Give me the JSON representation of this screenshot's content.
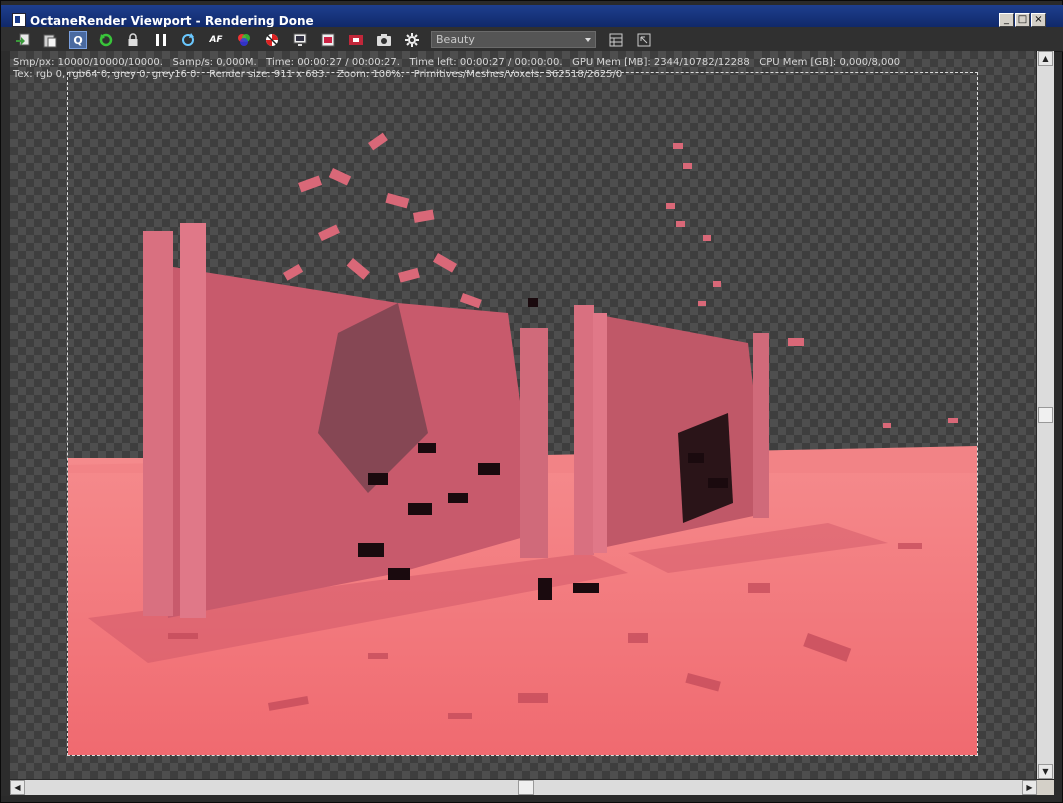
{
  "window": {
    "title": "OctaneRender Viewport - Rendering Done",
    "controls": {
      "minimize": "_",
      "maximize": "□",
      "close": "×"
    }
  },
  "toolbar": {
    "buttons": [
      {
        "name": "send-scene-icon"
      },
      {
        "name": "clipboard-icon"
      },
      {
        "name": "q-region-icon",
        "label": "Q"
      },
      {
        "name": "restart-icon"
      },
      {
        "name": "lock-icon"
      },
      {
        "name": "pause-icon"
      },
      {
        "name": "refresh-icon"
      },
      {
        "name": "af-focus-icon",
        "label": "AF"
      },
      {
        "name": "color-picker-icon"
      },
      {
        "name": "material-picker-icon"
      },
      {
        "name": "display-icon"
      },
      {
        "name": "film-icon"
      },
      {
        "name": "render-region-icon"
      },
      {
        "name": "camera-icon"
      },
      {
        "name": "settings-gear-icon"
      }
    ],
    "pass_select": "Beauty",
    "right_buttons": [
      {
        "name": "layout-icon"
      },
      {
        "name": "fit-view-icon"
      }
    ]
  },
  "status": {
    "line1": "Smp/px: 10000/10000/10000.   Samp/s: 0,000M.   Time: 00:00:27 / 00:00:27.   Time left: 00:00:27 / 00:00:00.   GPU Mem [MB]: 2344/10782/12288   CPU Mem [GB]: 0,000/8,000",
    "line2": "Tex: rgb 0, rgb64 0, grey 0, grey16 0.   Render size: 911 x 683.   Zoom: 100%.   Primitives/Meshes/Voxels: 362518/2625/0"
  },
  "scrollbars": {
    "up": "▲",
    "down": "▼",
    "left": "◀",
    "right": "▶"
  },
  "colors": {
    "title_bg": "#1a3a8a",
    "accent": "#4a6aa0",
    "render_floor": "#f07478",
    "render_wall": "#c85868"
  }
}
